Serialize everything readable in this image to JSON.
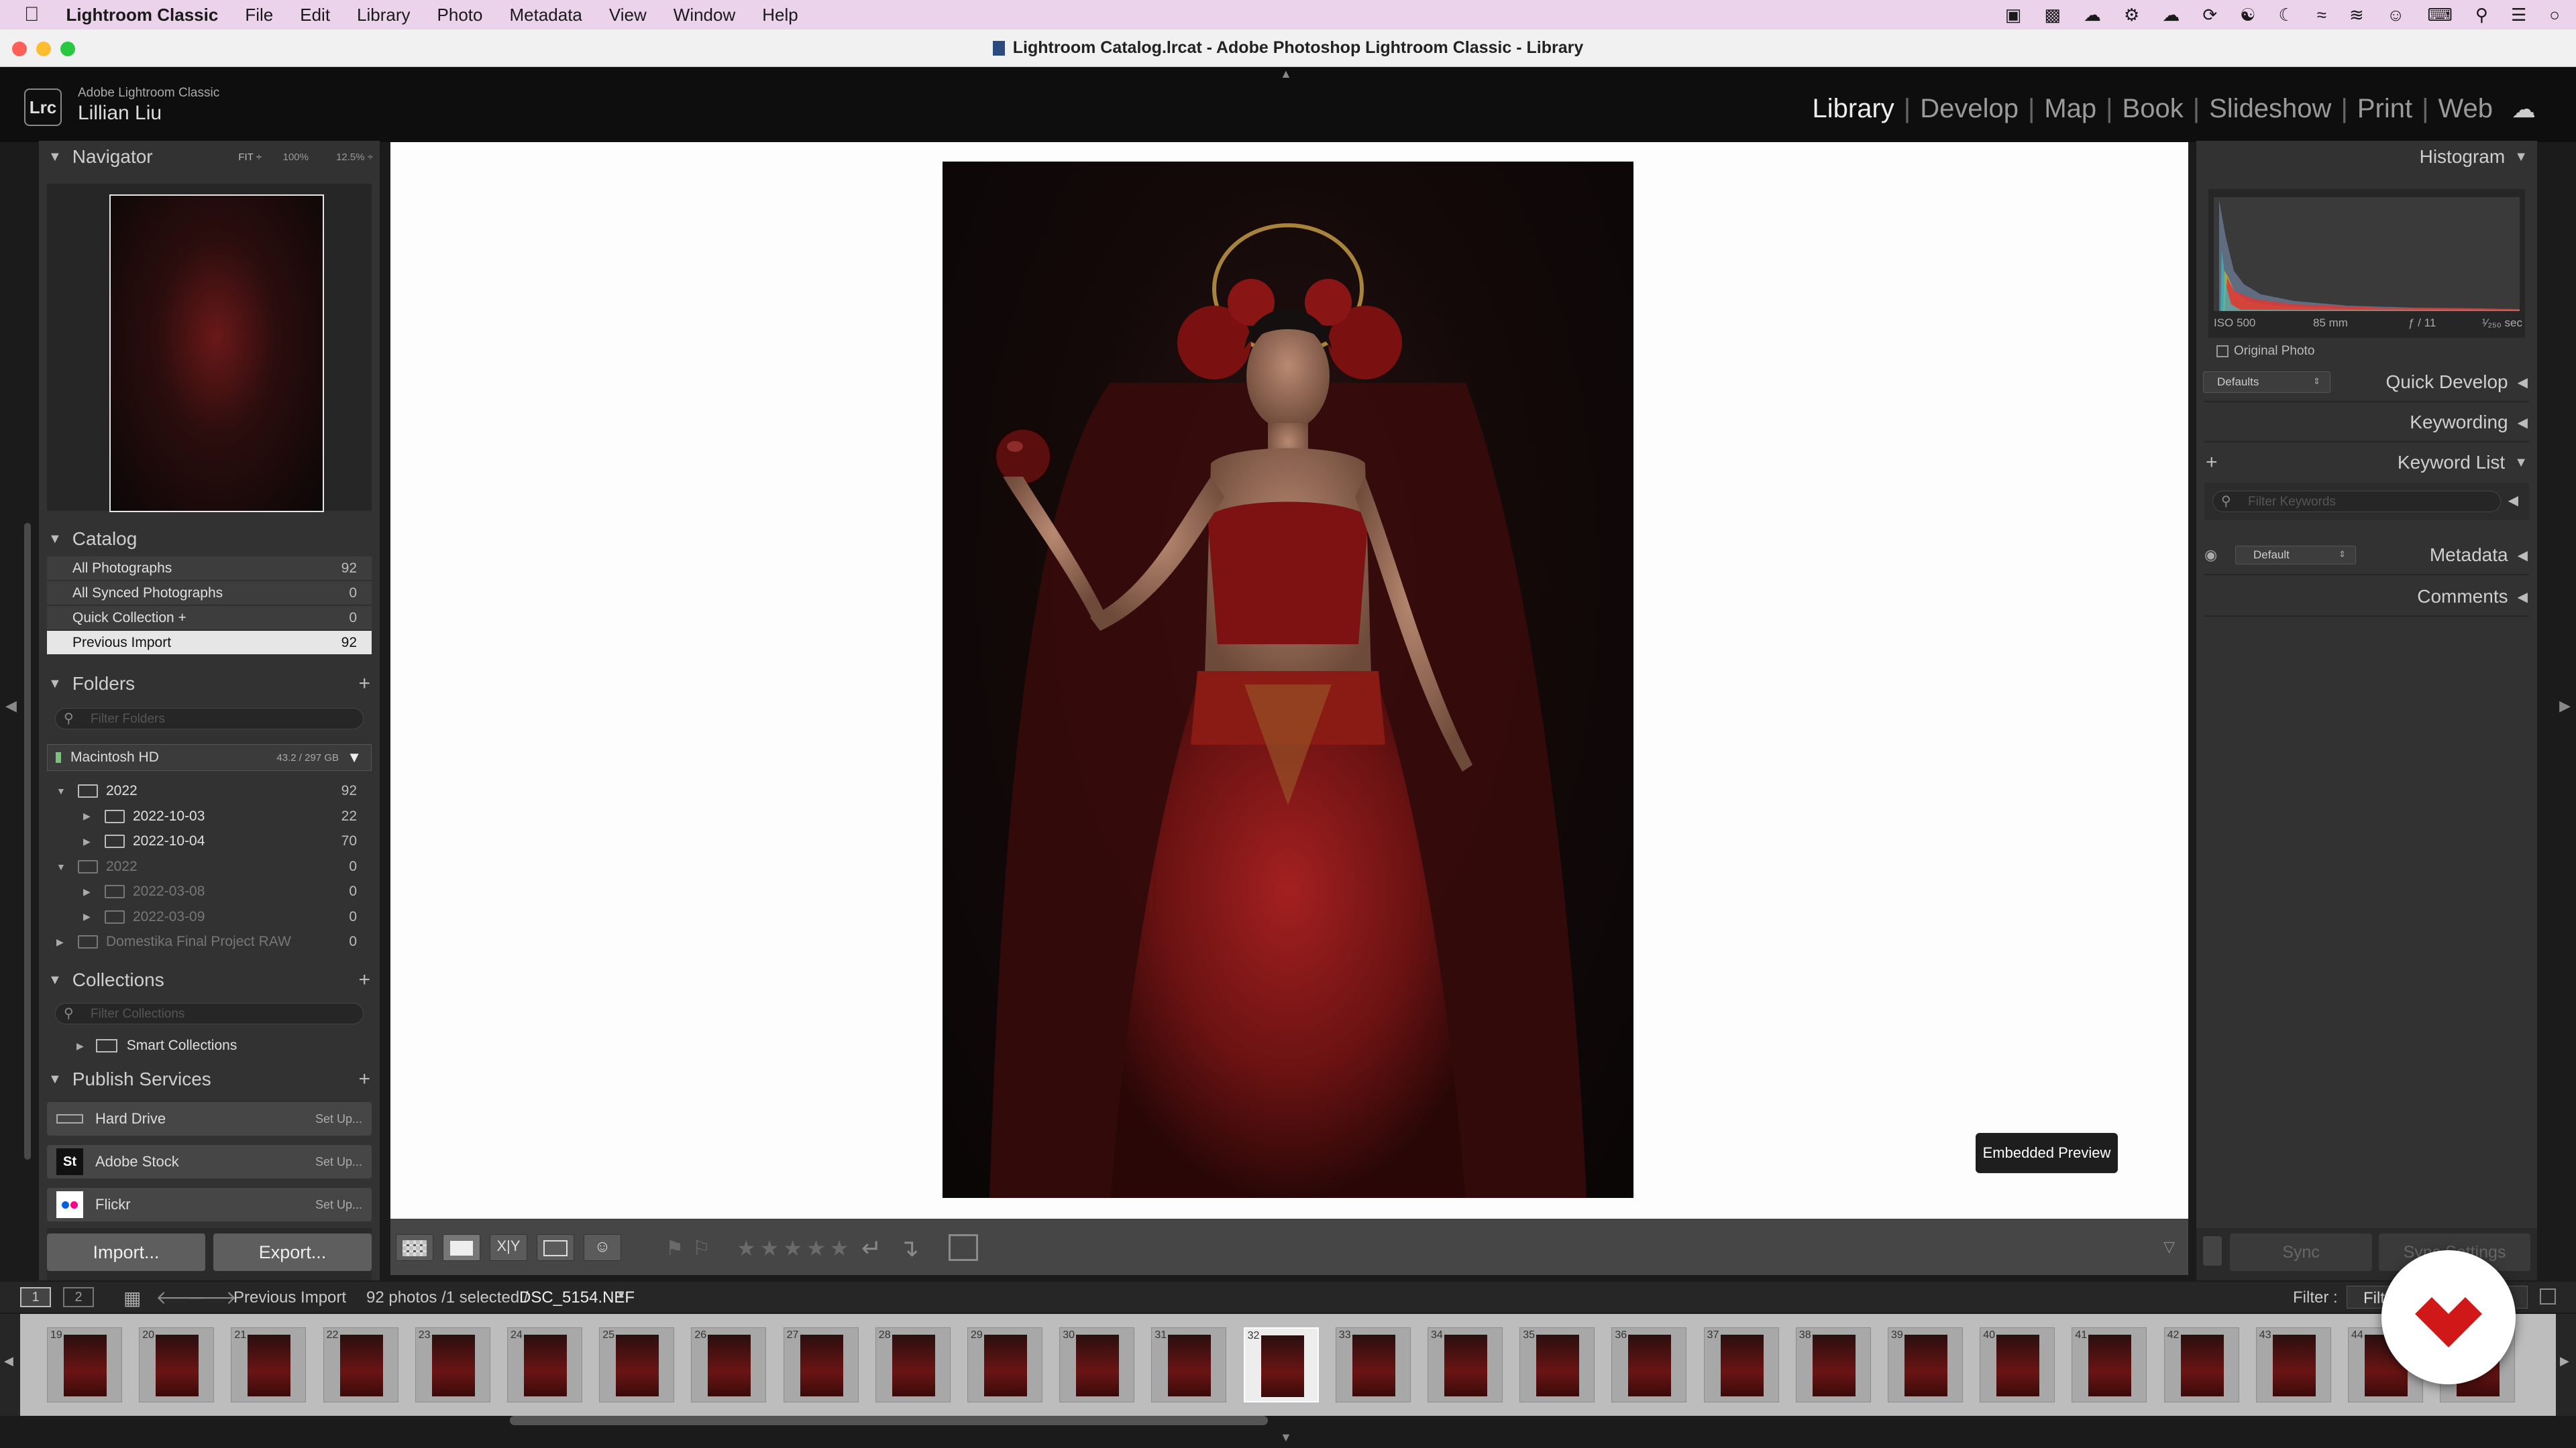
{
  "menubar": {
    "app_name": "Lightroom Classic",
    "items": [
      "File",
      "Edit",
      "Library",
      "Photo",
      "Metadata",
      "View",
      "Window",
      "Help"
    ]
  },
  "window": {
    "title": "Lightroom Catalog.lrcat - Adobe Photoshop Lightroom Classic - Library"
  },
  "identity": {
    "logo": "Lrc",
    "product": "Adobe Lightroom Classic",
    "user": "Lillian Liu"
  },
  "modules": {
    "items": [
      "Library",
      "Develop",
      "Map",
      "Book",
      "Slideshow",
      "Print",
      "Web"
    ],
    "active": "Library",
    "separator": "|"
  },
  "navigator": {
    "title": "Navigator",
    "zoom_fit": "FIT ÷",
    "zoom_100": "100%",
    "zoom_125": "12.5% ÷"
  },
  "catalog": {
    "title": "Catalog",
    "items": [
      {
        "label": "All Photographs",
        "count": "92"
      },
      {
        "label": "All Synced Photographs",
        "count": "0"
      },
      {
        "label": "Quick Collection +",
        "count": "0"
      },
      {
        "label": "Previous Import",
        "count": "92"
      }
    ]
  },
  "folders": {
    "title": "Folders",
    "filter_placeholder": "Filter Folders",
    "volume": {
      "name": "Macintosh HD",
      "size": "43.2 / 297 GB"
    },
    "tree": [
      {
        "label": "2022",
        "count": "92",
        "level": 0,
        "expanded": true,
        "dim": false
      },
      {
        "label": "2022-10-03",
        "count": "22",
        "level": 1,
        "expanded": false,
        "dim": false
      },
      {
        "label": "2022-10-04",
        "count": "70",
        "level": 1,
        "expanded": false,
        "dim": false
      },
      {
        "label": "2022",
        "count": "0",
        "level": 0,
        "expanded": true,
        "dim": true
      },
      {
        "label": "2022-03-08",
        "count": "0",
        "level": 1,
        "expanded": false,
        "dim": true
      },
      {
        "label": "2022-03-09",
        "count": "0",
        "level": 1,
        "expanded": false,
        "dim": true
      },
      {
        "label": "Domestika Final Project RAW",
        "count": "0",
        "level": -1,
        "expanded": false,
        "dim": true
      }
    ]
  },
  "collections": {
    "title": "Collections",
    "filter_placeholder": "Filter Collections",
    "smart": "Smart Collections"
  },
  "publish": {
    "title": "Publish Services",
    "services": [
      {
        "name": "Hard Drive",
        "action": "Set Up..."
      },
      {
        "name": "Adobe Stock",
        "action": "Set Up..."
      },
      {
        "name": "Flickr",
        "action": "Set Up..."
      }
    ]
  },
  "buttons": {
    "import": "Import...",
    "export": "Export...",
    "sync": "Sync",
    "sync_settings": "Sync Settings"
  },
  "histogram": {
    "title": "Histogram",
    "iso": "ISO 500",
    "focal": "85 mm",
    "aperture": "ƒ / 11",
    "shutter": "¹⁄₂₅₀ sec",
    "original_photo": "Original Photo"
  },
  "right_panels": {
    "quick_develop": "Quick Develop",
    "quick_preset": "Defaults",
    "keywording": "Keywording",
    "keyword_list": "Keyword List",
    "keyword_filter": "Filter Keywords",
    "metadata": "Metadata",
    "metadata_preset": "Default",
    "comments": "Comments"
  },
  "viewer": {
    "badge": "Embedded Preview"
  },
  "filmstrip_bar": {
    "screen1": "1",
    "screen2": "2",
    "source": "Previous Import",
    "summary": "92 photos /1 selected /",
    "filename": "DSC_5154.NEF",
    "filter_label": "Filter :",
    "filter_value": "Filte"
  },
  "filmstrip": {
    "numbers": [
      "19",
      "20",
      "21",
      "22",
      "23",
      "24",
      "25",
      "26",
      "27",
      "28",
      "29",
      "30",
      "31",
      "32",
      "33",
      "34",
      "35",
      "36",
      "37",
      "38",
      "39",
      "40",
      "41",
      "42",
      "43",
      "44",
      "45"
    ],
    "selected_index": 13
  }
}
